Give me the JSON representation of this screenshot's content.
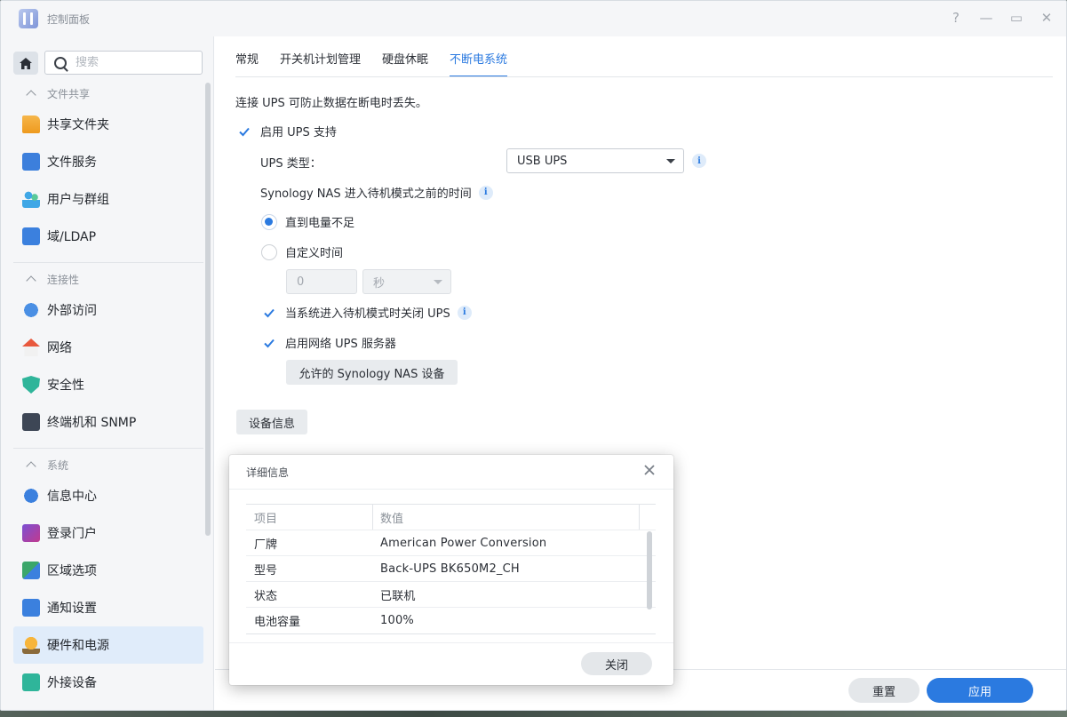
{
  "window": {
    "title": "控制面板",
    "controls": [
      "?",
      "—",
      "▭",
      "✕"
    ]
  },
  "sidebar": {
    "search_placeholder": "搜索",
    "sections": [
      {
        "label": "文件共享",
        "items": [
          {
            "label": "共享文件夹",
            "icon": "folder-icon"
          },
          {
            "label": "文件服务",
            "icon": "file-services-icon"
          },
          {
            "label": "用户与群组",
            "icon": "users-icon"
          },
          {
            "label": "域/LDAP",
            "icon": "ldap-icon"
          }
        ]
      },
      {
        "label": "连接性",
        "items": [
          {
            "label": "外部访问",
            "icon": "external-access-icon"
          },
          {
            "label": "网络",
            "icon": "network-icon"
          },
          {
            "label": "安全性",
            "icon": "shield-icon"
          },
          {
            "label": "终端机和 SNMP",
            "icon": "terminal-icon"
          }
        ]
      },
      {
        "label": "系统",
        "items": [
          {
            "label": "信息中心",
            "icon": "info-center-icon"
          },
          {
            "label": "登录门户",
            "icon": "login-portal-icon"
          },
          {
            "label": "区域选项",
            "icon": "region-icon"
          },
          {
            "label": "通知设置",
            "icon": "notification-icon"
          },
          {
            "label": "硬件和电源",
            "icon": "bulb-icon",
            "active": true
          },
          {
            "label": "外接设备",
            "icon": "external-device-icon"
          }
        ]
      }
    ]
  },
  "tabs": [
    "常规",
    "开关机计划管理",
    "硬盘休眠",
    "不断电系统"
  ],
  "active_tab": 3,
  "ups": {
    "description": "连接 UPS 可防止数据在断电时丢失。",
    "enable_label": "启用 UPS 支持",
    "type_label": "UPS 类型：",
    "type_value": "USB UPS",
    "standby_label": "Synology NAS 进入待机模式之前的时间",
    "radio_until_low": "直到电量不足",
    "radio_custom": "自定义时间",
    "custom_value": "0",
    "custom_unit": "秒",
    "shutdown_ups_label": "当系统进入待机模式时关闭 UPS",
    "network_ups_label": "启用网络 UPS 服务器",
    "allowed_devices_button": "允许的 Synology NAS 设备",
    "device_info_button": "设备信息"
  },
  "footer": {
    "reset": "重置",
    "apply": "应用"
  },
  "dialog": {
    "title": "详细信息",
    "col_item": "项目",
    "col_value": "数值",
    "rows": [
      {
        "item": "厂牌",
        "value": "American Power Conversion"
      },
      {
        "item": "型号",
        "value": "Back-UPS BK650M2_CH"
      },
      {
        "item": "状态",
        "value": "已联机"
      },
      {
        "item": "电池容量",
        "value": "100%"
      }
    ],
    "close_button": "关闭"
  },
  "colors": {
    "accent": "#2b7ae0",
    "sidebar_bg": "#f5f6f8",
    "active_bg": "#e0ecfa"
  }
}
